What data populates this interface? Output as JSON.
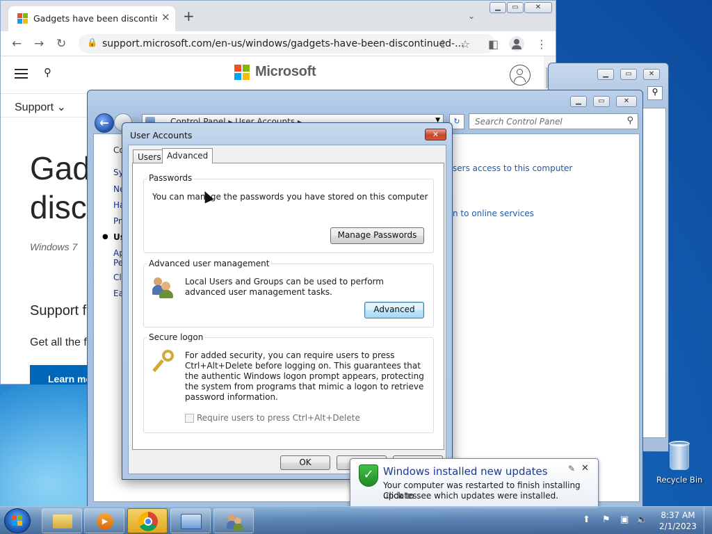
{
  "chrome": {
    "tab_title": "Gadgets have been discontinued",
    "url": "support.microsoft.com/en-us/windows/gadgets-have-been-discontinued-...",
    "page": {
      "brand": "Microsoft",
      "support_menu": "Support",
      "heading_line1": "Gadg",
      "heading_line2": "disco",
      "subtitle": "Windows 7",
      "section_heading": "Support f",
      "body_text": "Get all the f",
      "button_label": "Learn mo"
    }
  },
  "control_panel": {
    "breadcrumb": "Control Panel  ▸  User Accounts  ▸",
    "search_placeholder": "Search Control Panel",
    "sidebar": [
      "Co",
      "Sy",
      "Ne",
      "Ha",
      "Pr",
      "Us",
      "Ap",
      "Pe",
      "Cl",
      "Ea"
    ],
    "link_1": "sers access to this computer",
    "link_2": "n to online services"
  },
  "user_accounts": {
    "title": "User Accounts",
    "tabs": [
      "Users",
      "Advanced"
    ],
    "passwords": {
      "title": "Passwords",
      "text": "You can manage the passwords you have stored on this computer",
      "button": "Manage Passwords"
    },
    "advanced_mgmt": {
      "title": "Advanced user management",
      "text": "Local Users and Groups can be used to perform advanced user management tasks.",
      "button": "Advanced"
    },
    "secure_logon": {
      "title": "Secure logon",
      "text": "For added security, you can require users to press Ctrl+Alt+Delete before logging on. This guarantees that the authentic Windows logon prompt appears, protecting the system from programs that mimic a logon to retrieve password information.",
      "checkbox_label": "Require users to press Ctrl+Alt+Delete",
      "checkbox_checked": false
    },
    "ok": "OK"
  },
  "notification": {
    "title": "Windows installed new updates",
    "line1": "Your computer was restarted to finish installing updates.",
    "line2": "Click to see which updates were installed."
  },
  "desktop": {
    "recycle_bin": "Recycle Bin"
  },
  "taskbar": {
    "time": "8:37 AM",
    "date": "2/1/2023"
  }
}
